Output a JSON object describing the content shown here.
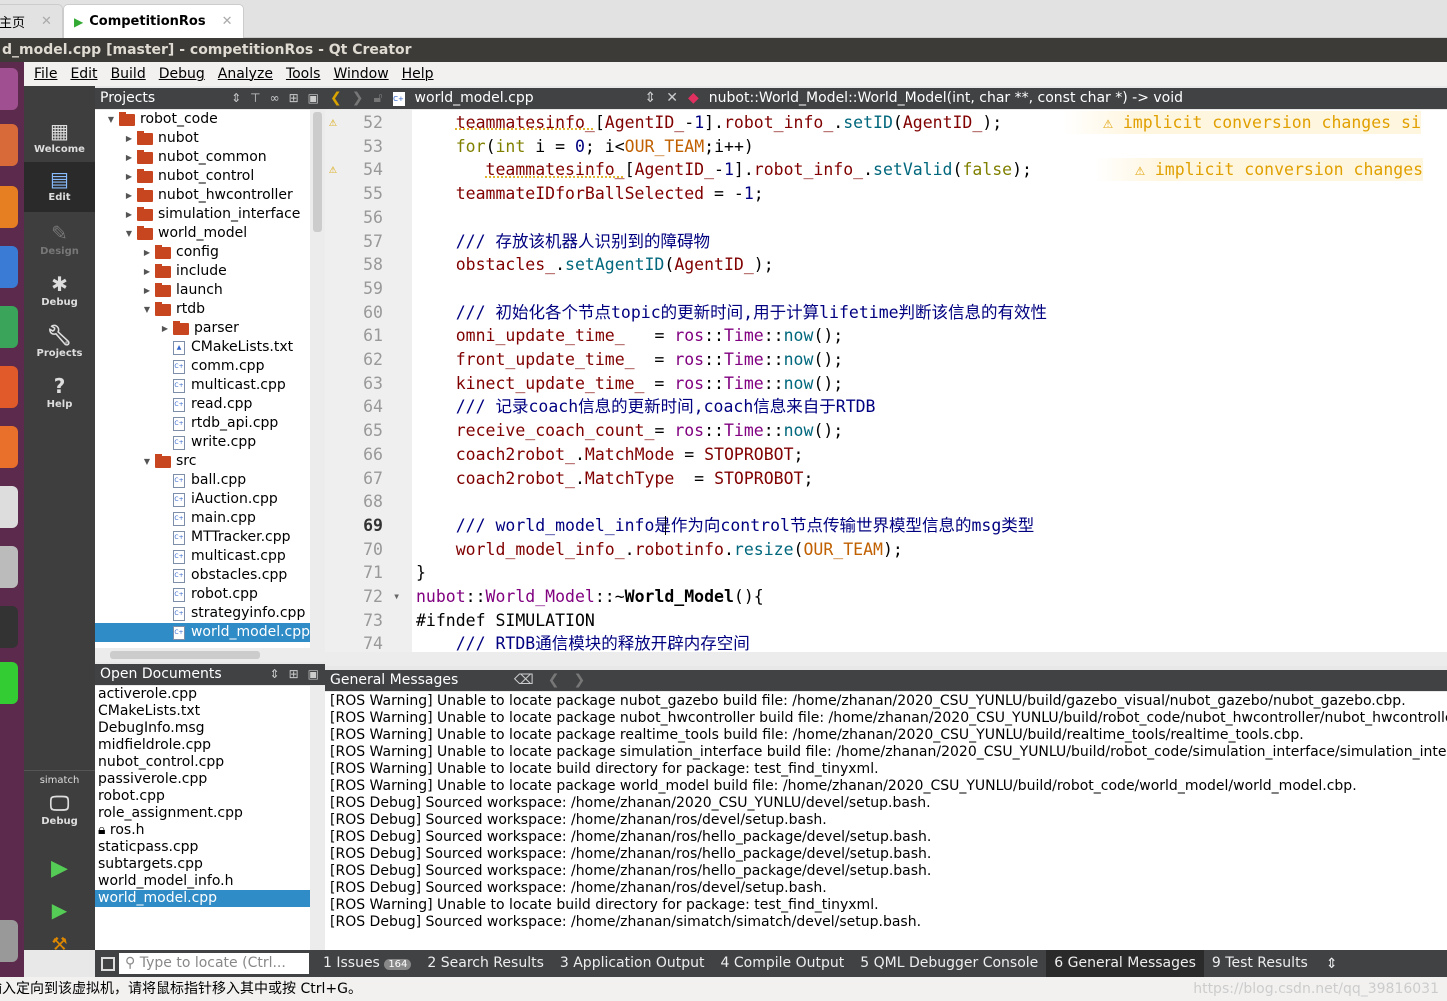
{
  "browser_tabs": [
    {
      "label": "主页"
    },
    {
      "label": "CompetitionRos"
    }
  ],
  "window_title": "d_model.cpp [master] - competitionRos - Qt Creator",
  "menu": [
    "File",
    "Edit",
    "Build",
    "Debug",
    "Analyze",
    "Tools",
    "Window",
    "Help"
  ],
  "modes": [
    {
      "label": "Welcome",
      "icon": "grid-icon"
    },
    {
      "label": "Edit",
      "icon": "edit-icon"
    },
    {
      "label": "Design",
      "icon": "pen-icon"
    },
    {
      "label": "Debug",
      "icon": "bug-icon"
    },
    {
      "label": "Projects",
      "icon": "wrench-icon"
    },
    {
      "label": "Help",
      "icon": "help-icon"
    }
  ],
  "kit": {
    "name": "simatch",
    "mode": "Debug"
  },
  "projects_panel": {
    "title": "Projects",
    "tree": [
      {
        "label": "robot_code",
        "depth": 0,
        "type": "folder",
        "open": true
      },
      {
        "label": "nubot",
        "depth": 1,
        "type": "folder"
      },
      {
        "label": "nubot_common",
        "depth": 1,
        "type": "folder"
      },
      {
        "label": "nubot_control",
        "depth": 1,
        "type": "folder"
      },
      {
        "label": "nubot_hwcontroller",
        "depth": 1,
        "type": "folder"
      },
      {
        "label": "simulation_interface",
        "depth": 1,
        "type": "folder"
      },
      {
        "label": "world_model",
        "depth": 1,
        "type": "folder",
        "open": true
      },
      {
        "label": "config",
        "depth": 2,
        "type": "folder"
      },
      {
        "label": "include",
        "depth": 2,
        "type": "folder"
      },
      {
        "label": "launch",
        "depth": 2,
        "type": "folder"
      },
      {
        "label": "rtdb",
        "depth": 2,
        "type": "folder",
        "open": true
      },
      {
        "label": "parser",
        "depth": 3,
        "type": "folder"
      },
      {
        "label": "CMakeLists.txt",
        "depth": 3,
        "type": "cmake"
      },
      {
        "label": "comm.cpp",
        "depth": 3,
        "type": "file"
      },
      {
        "label": "multicast.cpp",
        "depth": 3,
        "type": "file"
      },
      {
        "label": "read.cpp",
        "depth": 3,
        "type": "file"
      },
      {
        "label": "rtdb_api.cpp",
        "depth": 3,
        "type": "file"
      },
      {
        "label": "write.cpp",
        "depth": 3,
        "type": "file"
      },
      {
        "label": "src",
        "depth": 2,
        "type": "folder",
        "open": true
      },
      {
        "label": "ball.cpp",
        "depth": 3,
        "type": "file"
      },
      {
        "label": "iAuction.cpp",
        "depth": 3,
        "type": "file"
      },
      {
        "label": "main.cpp",
        "depth": 3,
        "type": "file"
      },
      {
        "label": "MTTracker.cpp",
        "depth": 3,
        "type": "file"
      },
      {
        "label": "multicast.cpp",
        "depth": 3,
        "type": "file"
      },
      {
        "label": "obstacles.cpp",
        "depth": 3,
        "type": "file"
      },
      {
        "label": "robot.cpp",
        "depth": 3,
        "type": "file"
      },
      {
        "label": "strategyinfo.cpp",
        "depth": 3,
        "type": "file"
      },
      {
        "label": "world_model.cpp",
        "depth": 3,
        "type": "file",
        "selected": true
      }
    ]
  },
  "open_documents": {
    "title": "Open Documents",
    "items": [
      "activerole.cpp",
      "CMakeLists.txt",
      "DebugInfo.msg",
      "midfieldrole.cpp",
      "nubot_control.cpp",
      "passiverole.cpp",
      "robot.cpp",
      "role_assignment.cpp",
      "ros.h",
      "staticpass.cpp",
      "subtargets.cpp",
      "world_model_info.h",
      "world_model.cpp"
    ],
    "selected": "world_model.cpp",
    "locked": "ros.h"
  },
  "editor": {
    "file": "world_model.cpp",
    "function": "nubot::World_Model::World_Model(int, char **, const char *) -> void",
    "current_line": 69,
    "lines": [
      {
        "n": 52,
        "warn": "implicit conversion changes si",
        "t": [
          [
            "    ",
            "d"
          ],
          [
            "teammatesinfo_",
            "v u"
          ],
          [
            "[",
            "d"
          ],
          [
            "AgentID_",
            "v"
          ],
          [
            "-",
            "d"
          ],
          [
            "1",
            "n"
          ],
          [
            "].",
            "d"
          ],
          [
            "robot_info_",
            "v"
          ],
          [
            ".",
            "d"
          ],
          [
            "setID",
            "f"
          ],
          [
            "(",
            "d"
          ],
          [
            "AgentID_",
            "v"
          ],
          [
            ");",
            "d"
          ]
        ]
      },
      {
        "n": 53,
        "t": [
          [
            "    ",
            "d"
          ],
          [
            "for",
            "k"
          ],
          [
            "(",
            "d"
          ],
          [
            "int",
            "k"
          ],
          [
            " i = ",
            "d"
          ],
          [
            "0",
            "n"
          ],
          [
            "; i<",
            "d"
          ],
          [
            "OUR_TEAM",
            "m"
          ],
          [
            ";i++)",
            "d"
          ]
        ]
      },
      {
        "n": 54,
        "warn": "implicit conversion changes",
        "t": [
          [
            "       ",
            "d"
          ],
          [
            "teammatesinfo_",
            "v u"
          ],
          [
            "[",
            "d"
          ],
          [
            "AgentID_",
            "v"
          ],
          [
            "-",
            "d"
          ],
          [
            "1",
            "n"
          ],
          [
            "].",
            "d"
          ],
          [
            "robot_info_",
            "v"
          ],
          [
            ".",
            "d"
          ],
          [
            "setValid",
            "f"
          ],
          [
            "(",
            "d"
          ],
          [
            "false",
            "k"
          ],
          [
            ");",
            "d"
          ]
        ]
      },
      {
        "n": 55,
        "t": [
          [
            "    ",
            "d"
          ],
          [
            "teammateIDforBallSelected",
            "v"
          ],
          [
            " = -",
            "d"
          ],
          [
            "1",
            "n"
          ],
          [
            ";",
            "d"
          ]
        ]
      },
      {
        "n": 56,
        "t": []
      },
      {
        "n": 57,
        "t": [
          [
            "    ",
            "d"
          ],
          [
            "/// 存放该机器人识别到的障碍物",
            "c"
          ]
        ]
      },
      {
        "n": 58,
        "t": [
          [
            "    ",
            "d"
          ],
          [
            "obstacles_",
            "v"
          ],
          [
            ".",
            "d"
          ],
          [
            "setAgentID",
            "f"
          ],
          [
            "(",
            "d"
          ],
          [
            "AgentID_",
            "v"
          ],
          [
            ");",
            "d"
          ]
        ]
      },
      {
        "n": 59,
        "t": []
      },
      {
        "n": 60,
        "t": [
          [
            "    ",
            "d"
          ],
          [
            "/// 初始化各个节点topic的更新时间,用于计算lifetime判断该信息的有效性",
            "c"
          ]
        ]
      },
      {
        "n": 61,
        "t": [
          [
            "    ",
            "d"
          ],
          [
            "omni_update_time_",
            "v"
          ],
          [
            "   = ",
            "d"
          ],
          [
            "ros",
            "p"
          ],
          [
            "::",
            "d"
          ],
          [
            "Time",
            "p"
          ],
          [
            "::",
            "d"
          ],
          [
            "now",
            "f"
          ],
          [
            "();",
            "d"
          ]
        ]
      },
      {
        "n": 62,
        "t": [
          [
            "    ",
            "d"
          ],
          [
            "front_update_time_",
            "v"
          ],
          [
            "  = ",
            "d"
          ],
          [
            "ros",
            "p"
          ],
          [
            "::",
            "d"
          ],
          [
            "Time",
            "p"
          ],
          [
            "::",
            "d"
          ],
          [
            "now",
            "f"
          ],
          [
            "();",
            "d"
          ]
        ]
      },
      {
        "n": 63,
        "t": [
          [
            "    ",
            "d"
          ],
          [
            "kinect_update_time_",
            "v"
          ],
          [
            " = ",
            "d"
          ],
          [
            "ros",
            "p"
          ],
          [
            "::",
            "d"
          ],
          [
            "Time",
            "p"
          ],
          [
            "::",
            "d"
          ],
          [
            "now",
            "f"
          ],
          [
            "();",
            "d"
          ]
        ]
      },
      {
        "n": 64,
        "t": [
          [
            "    ",
            "d"
          ],
          [
            "/// 记录coach信息的更新时间,coach信息来自于RTDB",
            "c"
          ]
        ]
      },
      {
        "n": 65,
        "t": [
          [
            "    ",
            "d"
          ],
          [
            "receive_coach_count_",
            "v"
          ],
          [
            "= ",
            "d"
          ],
          [
            "ros",
            "p"
          ],
          [
            "::",
            "d"
          ],
          [
            "Time",
            "p"
          ],
          [
            "::",
            "d"
          ],
          [
            "now",
            "f"
          ],
          [
            "();",
            "d"
          ]
        ]
      },
      {
        "n": 66,
        "t": [
          [
            "    ",
            "d"
          ],
          [
            "coach2robot_",
            "v"
          ],
          [
            ".",
            "d"
          ],
          [
            "MatchMode",
            "v"
          ],
          [
            " = ",
            "d"
          ],
          [
            "STOPROBOT",
            "v"
          ],
          [
            ";",
            "d"
          ]
        ]
      },
      {
        "n": 67,
        "t": [
          [
            "    ",
            "d"
          ],
          [
            "coach2robot_",
            "v"
          ],
          [
            ".",
            "d"
          ],
          [
            "MatchType",
            "v"
          ],
          [
            "  = ",
            "d"
          ],
          [
            "STOPROBOT",
            "v"
          ],
          [
            ";",
            "d"
          ]
        ]
      },
      {
        "n": 68,
        "t": []
      },
      {
        "n": 69,
        "t": [
          [
            "    ",
            "d"
          ],
          [
            "/// world_model_info是作为向control节点传输世界模型信息的msg类型",
            "c"
          ]
        ]
      },
      {
        "n": 70,
        "t": [
          [
            "    ",
            "d"
          ],
          [
            "world_model_info_",
            "v"
          ],
          [
            ".",
            "d"
          ],
          [
            "robotinfo",
            "v"
          ],
          [
            ".",
            "d"
          ],
          [
            "resize",
            "f"
          ],
          [
            "(",
            "d"
          ],
          [
            "OUR_TEAM",
            "m"
          ],
          [
            ");",
            "d"
          ]
        ]
      },
      {
        "n": 71,
        "t": [
          [
            "}",
            "d"
          ]
        ]
      },
      {
        "n": 72,
        "t": [
          [
            "nubot",
            "p"
          ],
          [
            "::",
            "d"
          ],
          [
            "World_Model",
            "p"
          ],
          [
            "::~",
            "d"
          ],
          [
            "World_Model",
            "b"
          ],
          [
            "(){",
            "d"
          ]
        ]
      },
      {
        "n": 73,
        "t": [
          [
            "#ifndef SIMULATION",
            "d"
          ]
        ]
      },
      {
        "n": 74,
        "t": [
          [
            "    ",
            "d"
          ],
          [
            "/// RTDB通信模块的释放开辟内存空间",
            "c"
          ]
        ]
      }
    ]
  },
  "general_messages": {
    "title": "General Messages",
    "lines": [
      "[ROS Warning] Unable to locate package nubot_gazebo build file: /home/zhanan/2020_CSU_YUNLU/build/gazebo_visual/nubot_gazebo/nubot_gazebo.cbp.",
      "[ROS Warning] Unable to locate package nubot_hwcontroller build file: /home/zhanan/2020_CSU_YUNLU/build/robot_code/nubot_hwcontroller/nubot_hwcontroller.",
      "[ROS Warning] Unable to locate package realtime_tools build file: /home/zhanan/2020_CSU_YUNLU/build/realtime_tools/realtime_tools.cbp.",
      "[ROS Warning] Unable to locate package simulation_interface build file: /home/zhanan/2020_CSU_YUNLU/build/robot_code/simulation_interface/simulation_interfac",
      "[ROS Warning] Unable to locate build directory for package: test_find_tinyxml.",
      "[ROS Warning] Unable to locate package world_model build file: /home/zhanan/2020_CSU_YUNLU/build/robot_code/world_model/world_model.cbp.",
      "[ROS Debug] Sourced workspace: /home/zhanan/2020_CSU_YUNLU/devel/setup.bash.",
      "[ROS Debug] Sourced workspace: /home/zhanan/ros/devel/setup.bash.",
      "[ROS Debug] Sourced workspace: /home/zhanan/ros/hello_package/devel/setup.bash.",
      "[ROS Debug] Sourced workspace: /home/zhanan/ros/hello_package/devel/setup.bash.",
      "[ROS Debug] Sourced workspace: /home/zhanan/ros/hello_package/devel/setup.bash.",
      "[ROS Debug] Sourced workspace: /home/zhanan/ros/devel/setup.bash.",
      "[ROS Warning] Unable to locate build directory for package: test_find_tinyxml.",
      "[ROS Debug] Sourced workspace: /home/zhanan/simatch/simatch/devel/setup.bash."
    ]
  },
  "bottom": {
    "locate_placeholder": "Type to locate (Ctrl...",
    "tabs": [
      {
        "label": "1 Issues",
        "badge": "164"
      },
      {
        "label": "2 Search Results"
      },
      {
        "label": "3 Application Output"
      },
      {
        "label": "4 Compile Output"
      },
      {
        "label": "5 QML Debugger Console"
      },
      {
        "label": "6 General Messages",
        "active": true
      },
      {
        "label": "9 Test Results"
      }
    ]
  },
  "status_text": "输入定向到该虚拟机，请将鼠标指针移入其中或按 Ctrl+G。",
  "watermark": "https://blog.csdn.net/qq_39816031",
  "colors": {
    "accent": "#308cc6",
    "modebar": "#3e3e3e",
    "title_bar": "#3c3b37",
    "folder": "#c8461f"
  }
}
